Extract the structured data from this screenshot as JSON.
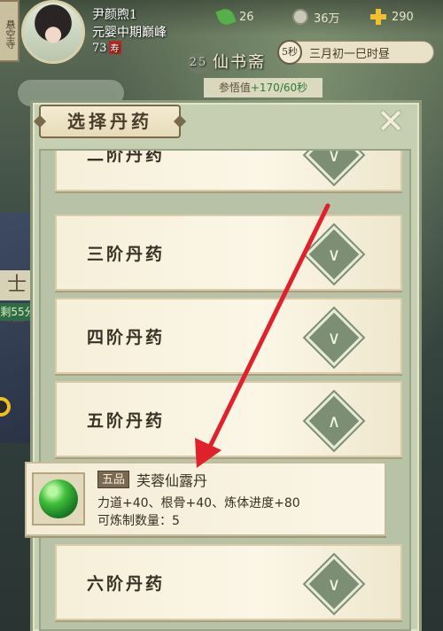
{
  "background": {
    "side_sign": "士居",
    "side_sign_time": "剩55分"
  },
  "hud": {
    "side_tab": "悬空寺",
    "player": {
      "name": "尹颜煦1",
      "realm": "元婴中期巅峰",
      "age": "73",
      "age_badge": "寿"
    },
    "resources": [
      {
        "icon": "leaf-icon",
        "value": "26"
      },
      {
        "icon": "spirit-stone-icon",
        "value": "36万"
      },
      {
        "icon": "gold-plus-icon",
        "value": "290"
      }
    ],
    "shop": {
      "level": "25",
      "name": "仙书斋"
    },
    "timer": {
      "seconds": "5秒",
      "text": "三月初一巳时昼"
    },
    "insight": {
      "label": "参悟值",
      "gain": "+170/60秒"
    }
  },
  "modal": {
    "title": "选择丹药",
    "close_icon": "close-x-icon",
    "tiers": [
      {
        "label": "二阶丹药",
        "state": "collapsed"
      },
      {
        "label": "三阶丹药",
        "state": "collapsed"
      },
      {
        "label": "四阶丹药",
        "state": "collapsed"
      },
      {
        "label": "五阶丹药",
        "state": "expanded"
      },
      {
        "label": "六阶丹药",
        "state": "collapsed"
      }
    ],
    "item": {
      "grade": "五品",
      "name": "芙蓉仙露丹",
      "effect": "力道+40、根骨+40、炼体进度+80",
      "count_label": "可炼制数量：",
      "count": "5"
    }
  },
  "overlay": {
    "arrow_color": "#e0202a"
  }
}
